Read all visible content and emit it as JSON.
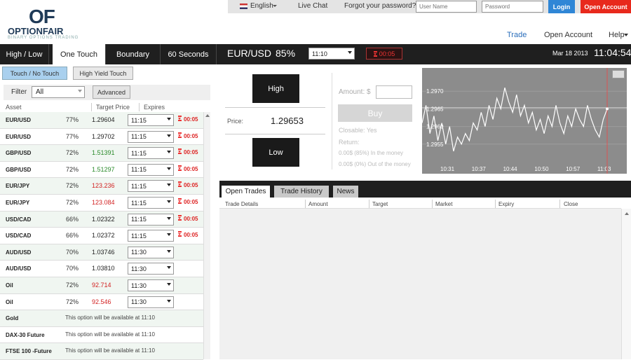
{
  "topbar": {
    "language": "English",
    "live_chat": "Live Chat",
    "forgot": "Forgot your password?",
    "username_placeholder": "User Name",
    "password_placeholder": "Password",
    "login": "Login",
    "open_account": "Open Account"
  },
  "logo": {
    "mark": "OF",
    "name": "OPTIONFAIR",
    "tagline": "BINARY OPTIONS TRADING"
  },
  "nav": {
    "trade": "Trade",
    "open_account": "Open Account",
    "help": "Help"
  },
  "option_tabs": [
    "High / Low",
    "One Touch",
    "Boundary",
    "60 Seconds"
  ],
  "sub_tabs": [
    "Touch / No Touch",
    "High Yield Touch"
  ],
  "filter": {
    "label": "Filter",
    "value": "All",
    "advanced": "Advanced"
  },
  "columns": {
    "asset": "Asset",
    "target": "Target Price",
    "expires": "Expires"
  },
  "assets": [
    {
      "asset": "EUR/USD",
      "payout": "77%",
      "price": "1.29604",
      "color": "#222222",
      "expiry": "11:15",
      "timer": "00:05"
    },
    {
      "asset": "EUR/USD",
      "payout": "77%",
      "price": "1.29702",
      "color": "#222222",
      "expiry": "11:15",
      "timer": "00:05"
    },
    {
      "asset": "GBP/USD",
      "payout": "72%",
      "price": "1.51391",
      "color": "#2a8a2a",
      "expiry": "11:15",
      "timer": "00:05"
    },
    {
      "asset": "GBP/USD",
      "payout": "72%",
      "price": "1.51297",
      "color": "#2a8a2a",
      "expiry": "11:15",
      "timer": "00:05"
    },
    {
      "asset": "EUR/JPY",
      "payout": "72%",
      "price": "123.236",
      "color": "#d22222",
      "expiry": "11:15",
      "timer": "00:05"
    },
    {
      "asset": "EUR/JPY",
      "payout": "72%",
      "price": "123.084",
      "color": "#d22222",
      "expiry": "11:15",
      "timer": "00:05"
    },
    {
      "asset": "USD/CAD",
      "payout": "66%",
      "price": "1.02322",
      "color": "#222222",
      "expiry": "11:15",
      "timer": "00:05"
    },
    {
      "asset": "USD/CAD",
      "payout": "66%",
      "price": "1.02372",
      "color": "#222222",
      "expiry": "11:15",
      "timer": "00:05"
    },
    {
      "asset": "AUD/USD",
      "payout": "70%",
      "price": "1.03746",
      "color": "#222222",
      "expiry": "11:30",
      "timer": ""
    },
    {
      "asset": "AUD/USD",
      "payout": "70%",
      "price": "1.03810",
      "color": "#222222",
      "expiry": "11:30",
      "timer": ""
    },
    {
      "asset": "Oil",
      "payout": "72%",
      "price": "92.714",
      "color": "#d22222",
      "expiry": "11:30",
      "timer": ""
    },
    {
      "asset": "Oil",
      "payout": "72%",
      "price": "92.546",
      "color": "#d22222",
      "expiry": "11:30",
      "timer": ""
    },
    {
      "asset": "Gold",
      "note": "This option will be available at 11:10"
    },
    {
      "asset": "DAX-30 Future",
      "note": "This option will be available at 11:10"
    },
    {
      "asset": "FTSE 100 -Future",
      "note": "This option will be available at 11:10"
    }
  ],
  "trade": {
    "pair": "EUR/USD",
    "payout": "85%",
    "expiry": "11:10",
    "timer": "00:05",
    "date": "Mar 18 2013",
    "clock": "11:04:54",
    "high": "High",
    "low": "Low",
    "price_label": "Price:",
    "price": "1.29653",
    "amount_label": "Amount: $",
    "buy": "Buy",
    "closable": "Closable: Yes",
    "return_label": "Return:",
    "return_in": "0.00$ (85%) In the money",
    "return_out": "0.00$ (0%) Out of the money"
  },
  "chart_data": {
    "type": "line",
    "x_ticks": [
      "10:31",
      "10:37",
      "10:44",
      "10:50",
      "10:57",
      "11:03"
    ],
    "y_ticks": [
      "1.2970",
      "1.2965",
      "1.2960",
      "1.2955"
    ],
    "ylim": [
      1.295,
      1.2975
    ],
    "current": 1.29653,
    "values": [
      1.2961,
      1.2966,
      1.2958,
      1.2963,
      1.2956,
      1.2961,
      1.2955,
      1.296,
      1.2953,
      1.2957,
      1.2955,
      1.2958,
      1.2956,
      1.2961,
      1.2959,
      1.2964,
      1.296,
      1.2966,
      1.2962,
      1.2968,
      1.2965,
      1.2971,
      1.2967,
      1.2964,
      1.2969,
      1.2963,
      1.2966,
      1.2961,
      1.2964,
      1.2959,
      1.2962,
      1.2958,
      1.2963,
      1.296,
      1.2966,
      1.2961,
      1.2958,
      1.2963,
      1.296,
      1.2965,
      1.2962,
      1.296,
      1.2966,
      1.2962,
      1.2959,
      1.2957,
      1.2962,
      1.2965
    ]
  },
  "bottom_tabs": [
    "Open Trades",
    "Trade History",
    "News"
  ],
  "table_headers": [
    "Trade Details",
    "Amount",
    "Target",
    "Market",
    "Expiry",
    "Close"
  ],
  "icons": {
    "flag": "uk-flag-icon",
    "hourglass": "hourglass-icon",
    "caret": "chevron-down-icon"
  }
}
